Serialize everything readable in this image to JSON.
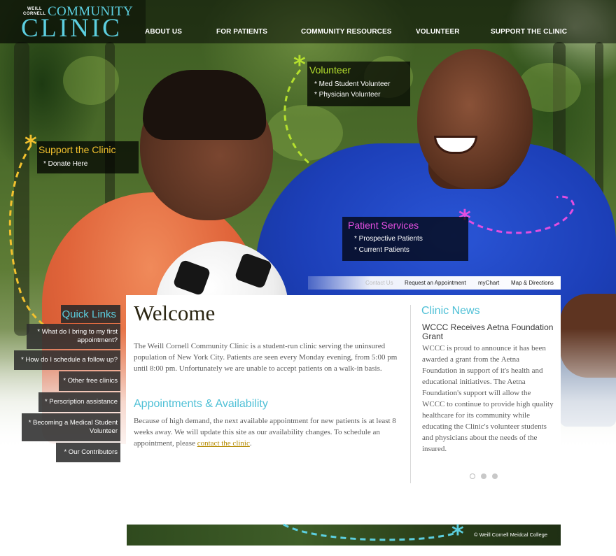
{
  "logo": {
    "weill": "WEILL",
    "cornell": "CORNELL",
    "community": "COMMUNITY",
    "clinic": "CLINIC"
  },
  "nav": {
    "items": [
      "ABOUT US",
      "FOR PATIENTS",
      "COMMUNITY RESOURCES",
      "VOLUNTEER",
      "SUPPORT THE CLINIC"
    ]
  },
  "callouts": {
    "volunteer": {
      "title": "Volunteer",
      "links": [
        "* Med Student Volunteer",
        "* Physician Volunteer"
      ],
      "color": "#b5e02e"
    },
    "support": {
      "title": "Support the Clinic",
      "links": [
        "* Donate Here"
      ],
      "color": "#f2c12e"
    },
    "patient_services": {
      "title": "Patient Services",
      "links": [
        "* Prospective Patients",
        "* Current Patients"
      ],
      "color": "#e24ee0"
    }
  },
  "utility": {
    "links": [
      "Contact Us",
      "Request an Appointment",
      "myChart",
      "Map & Directions"
    ]
  },
  "welcome": {
    "title": "Welcome",
    "intro": "The Weill Cornell Community Clinic is a student-run clinic serving the uninsured population of New York City. Patients are seen every Monday evening, from 5:00 pm until 8:00 pm. Unfortunately we are unable to accept patients on a walk-in basis.",
    "appointments_heading": "Appointments & Availability",
    "appointments_text": "Because of high demand, the next available appointment for new patients is at least 8 weeks away. We will update this site as our availability changes. To schedule an appointment, please",
    "contact_link": "contact the clinic",
    "period": "."
  },
  "news": {
    "title": "Clinic News",
    "headline": "WCCC Receives Aetna Foundation Grant",
    "body": "WCCC is proud to announce it has been awarded a grant from the Aetna Foundation in support of it's health and educational initiatives. The Aetna Foundation's support will allow the WCCC to continue to provide high quality healthcare for its community while educating the Clinic's volunteer students and physicians about the needs of the insured.",
    "slide_count": 3,
    "active_slide": 1
  },
  "quick_links": {
    "title": "Quick Links",
    "items": [
      [
        "* What do I bring to my first",
        "appointment?"
      ],
      [
        "* How do I schedule a follow up?"
      ],
      [
        "* Other free clinics"
      ],
      [
        "* Perscription assistance"
      ],
      [
        "* Becoming a Medical Student",
        "Volunteer"
      ],
      [
        "* Our Contributors"
      ]
    ]
  },
  "footer": {
    "copyright": "© Weill Cornell Meidcal College"
  },
  "colors": {
    "accent": "#4fc0d6",
    "logo": "#5ccfe0",
    "link_gold": "#b58a00"
  }
}
